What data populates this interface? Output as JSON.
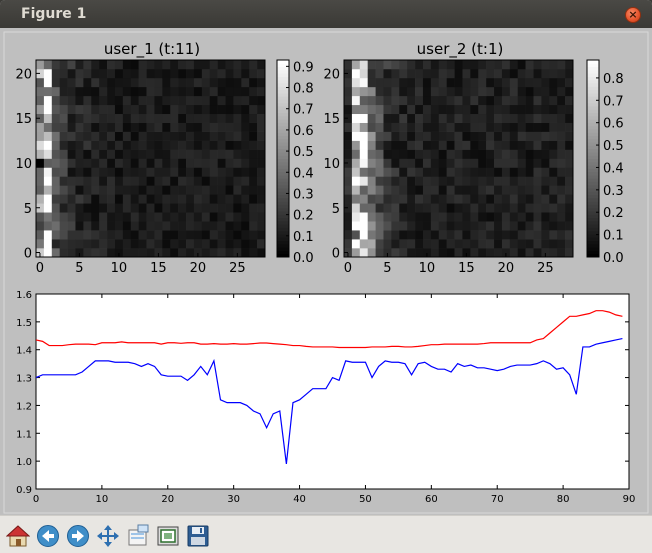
{
  "window": {
    "title": "Figure 1",
    "close_glyph": "×"
  },
  "toolbar": {
    "buttons": [
      {
        "name": "home-button",
        "icon": "home-icon",
        "label": "Home"
      },
      {
        "name": "back-button",
        "icon": "arrow-left-icon",
        "label": "Back"
      },
      {
        "name": "forward-button",
        "icon": "arrow-right-icon",
        "label": "Forward"
      },
      {
        "name": "pan-button",
        "icon": "move-icon",
        "label": "Pan"
      },
      {
        "name": "zoom-button",
        "icon": "zoom-rect-icon",
        "label": "Zoom"
      },
      {
        "name": "subplots-button",
        "icon": "subplots-icon",
        "label": "Subplots"
      },
      {
        "name": "save-button",
        "icon": "floppy-disk-icon",
        "label": "Save"
      }
    ]
  },
  "chart_data": [
    {
      "type": "heatmap",
      "title": "user_1 (t:11)",
      "x_ticks": [
        "0",
        "5",
        "10",
        "15",
        "20",
        "25"
      ],
      "y_ticks": [
        "0",
        "5",
        "10",
        "15",
        "20"
      ],
      "cols": 29,
      "rows": 22,
      "colorbar_ticks": [
        "0.0",
        "0.1",
        "0.2",
        "0.3",
        "0.4",
        "0.5",
        "0.6",
        "0.7",
        "0.8",
        "0.9"
      ],
      "colorbar_range": [
        0,
        0.93
      ],
      "column_profile": [
        0.55,
        0.8,
        0.28,
        0.2,
        0.16,
        0.14,
        0.13,
        0.12,
        0.11,
        0.11,
        0.1,
        0.1,
        0.1,
        0.1,
        0.1,
        0.1,
        0.1,
        0.1,
        0.1,
        0.1,
        0.1,
        0.1,
        0.1,
        0.1,
        0.1,
        0.1,
        0.1,
        0.1,
        0.1
      ],
      "seed": 11
    },
    {
      "type": "heatmap",
      "title": "user_2 (t:1)",
      "x_ticks": [
        "0",
        "5",
        "10",
        "15",
        "20",
        "25"
      ],
      "y_ticks": [
        "0",
        "5",
        "10",
        "15",
        "20"
      ],
      "cols": 29,
      "rows": 22,
      "colorbar_ticks": [
        "0.0",
        "0.1",
        "0.2",
        "0.3",
        "0.4",
        "0.5",
        "0.6",
        "0.7",
        "0.8"
      ],
      "colorbar_range": [
        0,
        0.88
      ],
      "column_profile": [
        0.15,
        0.65,
        0.75,
        0.4,
        0.25,
        0.18,
        0.15,
        0.13,
        0.12,
        0.12,
        0.11,
        0.11,
        0.11,
        0.11,
        0.11,
        0.11,
        0.11,
        0.11,
        0.11,
        0.11,
        0.11,
        0.11,
        0.11,
        0.11,
        0.11,
        0.11,
        0.11,
        0.11,
        0.11
      ],
      "seed": 1
    },
    {
      "type": "line",
      "x_ticks": [
        "0",
        "10",
        "20",
        "30",
        "40",
        "50",
        "60",
        "70",
        "80",
        "90"
      ],
      "y_ticks": [
        "0.9",
        "1.0",
        "1.1",
        "1.2",
        "1.3",
        "1.4",
        "1.5",
        "1.6"
      ],
      "xlim": [
        0,
        90
      ],
      "ylim": [
        0.9,
        1.6
      ],
      "series": [
        {
          "color": "#ff0000",
          "x": [
            0,
            1,
            2,
            3,
            4,
            5,
            6,
            7,
            8,
            9,
            10,
            11,
            12,
            13,
            14,
            15,
            16,
            17,
            18,
            19,
            20,
            21,
            22,
            23,
            24,
            25,
            26,
            27,
            28,
            29,
            30,
            31,
            32,
            33,
            34,
            35,
            36,
            37,
            38,
            39,
            40,
            41,
            42,
            43,
            44,
            45,
            46,
            47,
            48,
            49,
            50,
            51,
            52,
            53,
            54,
            55,
            56,
            57,
            58,
            59,
            60,
            61,
            62,
            63,
            64,
            65,
            66,
            67,
            68,
            69,
            70,
            71,
            72,
            73,
            74,
            75,
            76,
            77,
            78,
            79,
            80,
            81,
            82,
            83,
            84,
            85,
            86,
            87,
            88,
            89
          ],
          "y": [
            1.435,
            1.43,
            1.415,
            1.415,
            1.415,
            1.418,
            1.42,
            1.42,
            1.42,
            1.418,
            1.425,
            1.425,
            1.425,
            1.428,
            1.425,
            1.425,
            1.425,
            1.425,
            1.425,
            1.42,
            1.425,
            1.425,
            1.423,
            1.425,
            1.425,
            1.42,
            1.42,
            1.422,
            1.42,
            1.42,
            1.422,
            1.42,
            1.42,
            1.422,
            1.424,
            1.424,
            1.422,
            1.42,
            1.418,
            1.415,
            1.415,
            1.412,
            1.41,
            1.41,
            1.41,
            1.41,
            1.408,
            1.408,
            1.408,
            1.408,
            1.408,
            1.41,
            1.41,
            1.41,
            1.412,
            1.412,
            1.41,
            1.41,
            1.412,
            1.415,
            1.418,
            1.418,
            1.42,
            1.42,
            1.42,
            1.42,
            1.42,
            1.42,
            1.422,
            1.425,
            1.425,
            1.425,
            1.425,
            1.425,
            1.425,
            1.425,
            1.435,
            1.44,
            1.46,
            1.48,
            1.5,
            1.52,
            1.52,
            1.525,
            1.53,
            1.54,
            1.54,
            1.535,
            1.525,
            1.52
          ]
        },
        {
          "color": "#0000ff",
          "x": [
            0,
            1,
            2,
            3,
            4,
            5,
            6,
            7,
            8,
            9,
            10,
            11,
            12,
            13,
            14,
            15,
            16,
            17,
            18,
            19,
            20,
            21,
            22,
            23,
            24,
            25,
            26,
            27,
            28,
            29,
            30,
            31,
            32,
            33,
            34,
            35,
            36,
            37,
            38,
            39,
            40,
            41,
            42,
            43,
            44,
            45,
            46,
            47,
            48,
            49,
            50,
            51,
            52,
            53,
            54,
            55,
            56,
            57,
            58,
            59,
            60,
            61,
            62,
            63,
            64,
            65,
            66,
            67,
            68,
            69,
            70,
            71,
            72,
            73,
            74,
            75,
            76,
            77,
            78,
            79,
            80,
            81,
            82,
            83,
            84,
            85,
            86,
            87,
            88,
            89
          ],
          "y": [
            1.3,
            1.31,
            1.31,
            1.31,
            1.31,
            1.31,
            1.31,
            1.32,
            1.34,
            1.36,
            1.36,
            1.36,
            1.355,
            1.355,
            1.355,
            1.35,
            1.34,
            1.35,
            1.34,
            1.31,
            1.305,
            1.305,
            1.305,
            1.29,
            1.31,
            1.34,
            1.31,
            1.36,
            1.22,
            1.21,
            1.21,
            1.21,
            1.2,
            1.18,
            1.17,
            1.12,
            1.17,
            1.18,
            0.99,
            1.21,
            1.22,
            1.24,
            1.26,
            1.26,
            1.26,
            1.3,
            1.29,
            1.36,
            1.355,
            1.355,
            1.355,
            1.3,
            1.34,
            1.36,
            1.355,
            1.355,
            1.35,
            1.31,
            1.35,
            1.355,
            1.34,
            1.33,
            1.33,
            1.32,
            1.35,
            1.34,
            1.345,
            1.335,
            1.335,
            1.33,
            1.325,
            1.33,
            1.34,
            1.345,
            1.345,
            1.345,
            1.35,
            1.36,
            1.35,
            1.33,
            1.335,
            1.31,
            1.24,
            1.41,
            1.41,
            1.42,
            1.425,
            1.43,
            1.435,
            1.44
          ]
        }
      ]
    }
  ]
}
